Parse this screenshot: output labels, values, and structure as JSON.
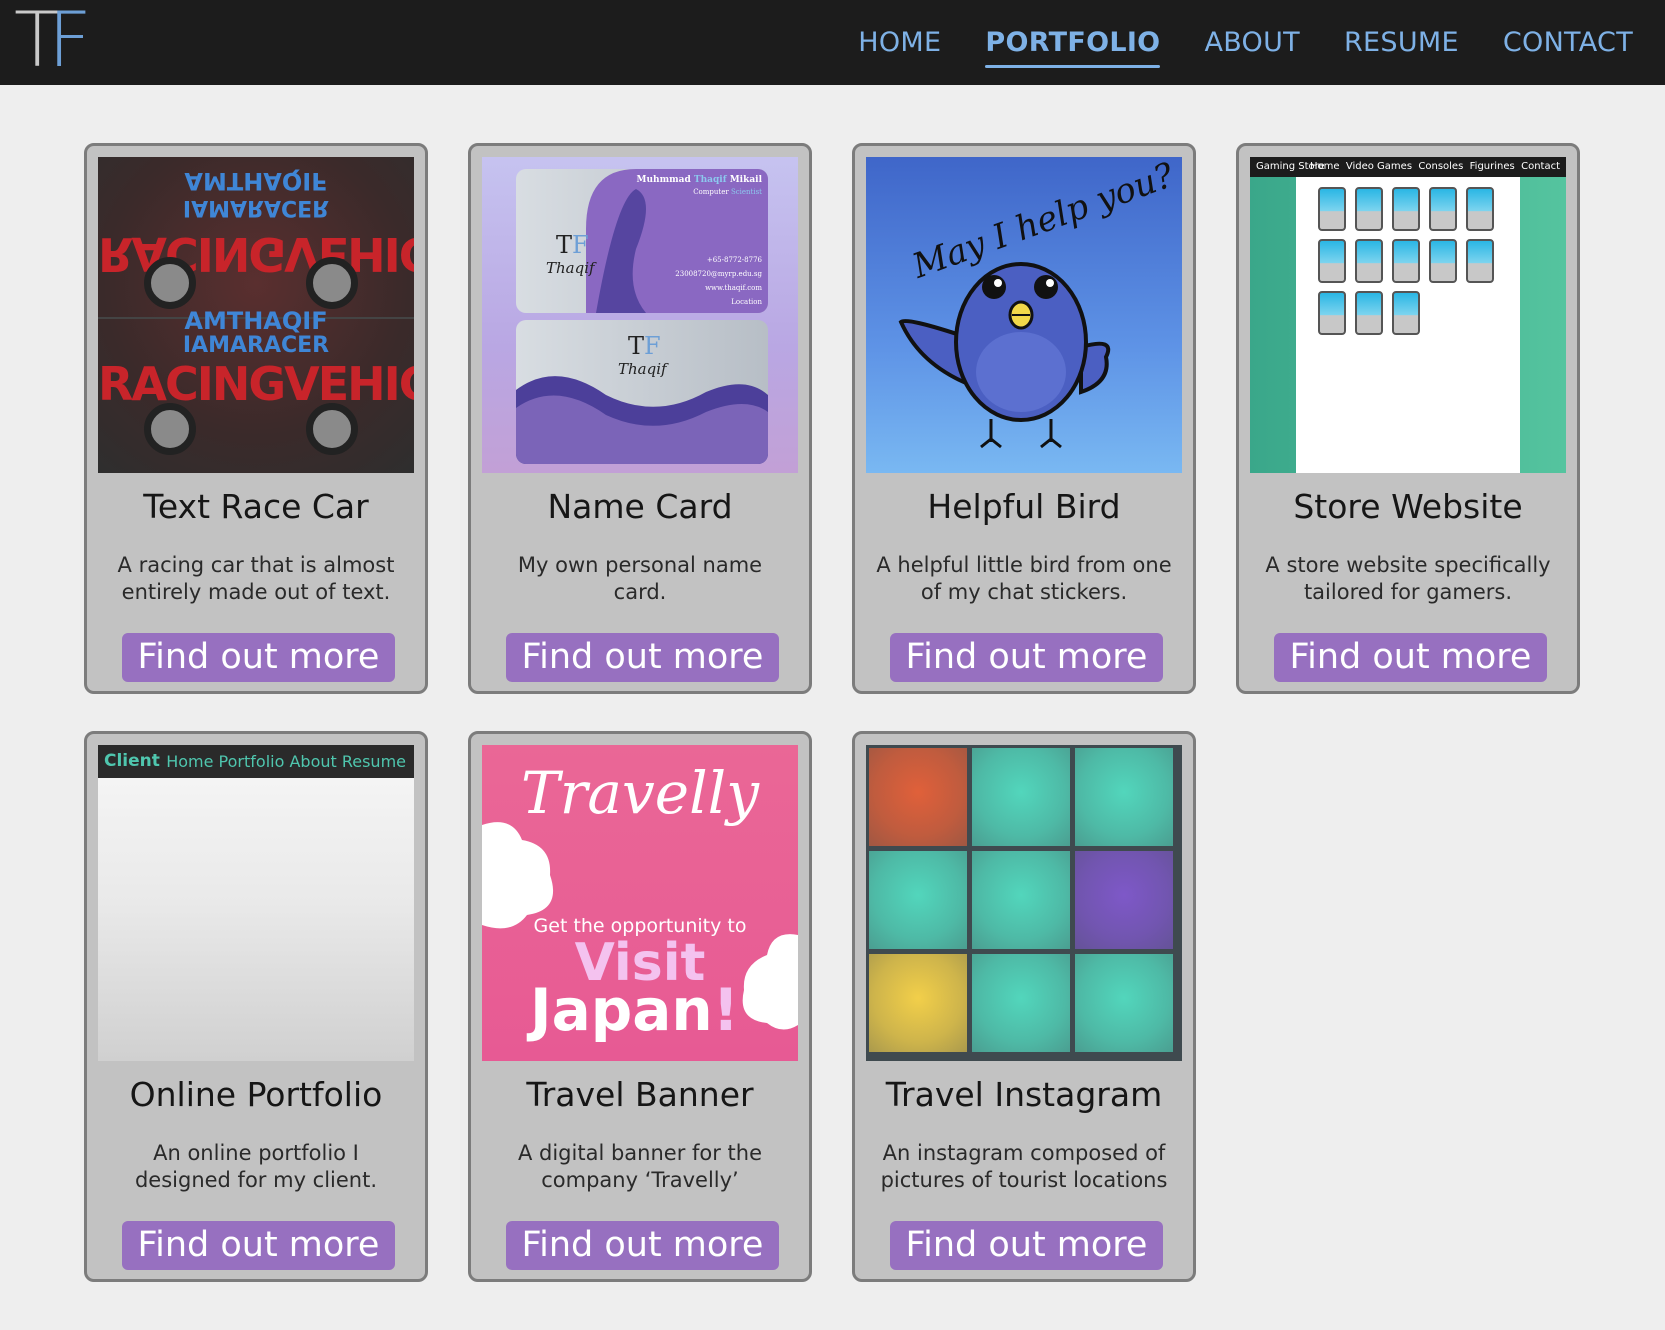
{
  "logo": {
    "t": "T",
    "f": "F"
  },
  "nav": {
    "items": [
      {
        "label": "HOME"
      },
      {
        "label": "PORTFOLIO",
        "active": true
      },
      {
        "label": "ABOUT"
      },
      {
        "label": "RESUME"
      },
      {
        "label": "CONTACT"
      }
    ]
  },
  "cards": [
    {
      "title": "Text Race Car",
      "desc": "A racing car that is almost entirely made out of text.",
      "button": "Find out more",
      "thumb": {
        "top_line1": "AMTHAQIF",
        "top_line2": "IAMARACER",
        "top_line3": "RACINGVEHICLE",
        "bottom_line1": "AMTHAQIF",
        "bottom_line2": "IAMARACER",
        "bottom_line3": "RACINGVEHICLE"
      }
    },
    {
      "title": "Name Card",
      "desc": "My own personal name card.",
      "button": "Find out more",
      "thumb": {
        "name_first": "Muhmmad",
        "name_mid": "Thaqif",
        "name_last": "Mikail",
        "role_a": "Computer",
        "role_b": "Scientist",
        "phone": "+65-8772-8776",
        "email": "23008720@myrp.edu.sg",
        "web": "www.thaqif.com",
        "location": "Location",
        "logo_t": "T",
        "logo_f": "F",
        "signature": "Thaqif"
      }
    },
    {
      "title": "Helpful Bird",
      "desc": "A helpful little bird from one of my chat stickers.",
      "button": "Find out more",
      "thumb": {
        "caption": "May I help you?"
      }
    },
    {
      "title": "Store Website",
      "desc": "A store website specifically tailored for gamers.",
      "button": "Find out more",
      "thumb": {
        "store_name": "Gaming Store",
        "links": "Home  Video Games  Consoles  Figurines  Contact"
      }
    },
    {
      "title": "Online Portfolio",
      "desc": "An online portfolio I designed for my client.",
      "button": "Find out more",
      "thumb": {
        "brand": "Client",
        "links": "Home Portfolio About Resume"
      }
    },
    {
      "title": "Travel Banner",
      "desc": "A digital banner for the company ‘Travelly’",
      "button": "Find out more",
      "thumb": {
        "brand": "Travelly",
        "tagline": "Get the opportunity to",
        "word1": "Visit",
        "word2": "Japan",
        "bang": "!"
      }
    },
    {
      "title": "Travel Instagram",
      "desc": "An instagram composed of pictures of tourist locations",
      "button": "Find out more",
      "thumb": {
        "tile_colors": [
          "#e0603a",
          "#52d6bc",
          "#52d6bc",
          "#52d6bc",
          "#52d6bc",
          "#7e58c8",
          "#f2cf4a",
          "#52d6bc",
          "#52d6bc"
        ]
      }
    }
  ],
  "colors": {
    "nav_bg": "#1c1c1c",
    "nav_link": "#7eb1e6",
    "page_bg": "#eeeeee",
    "card_bg": "#c2c2c2",
    "button_bg": "#9770c0"
  }
}
